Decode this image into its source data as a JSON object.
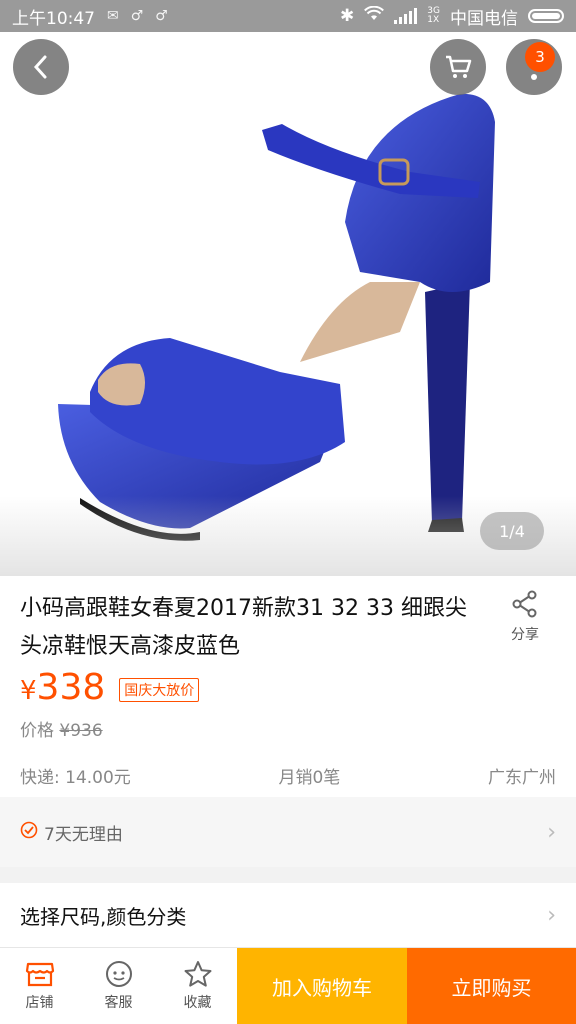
{
  "status_bar": {
    "time": "上午10:47",
    "carrier": "中国电信",
    "network_top": "3G",
    "network_bottom": "1X"
  },
  "gallery": {
    "pager": "1/4",
    "cart_badge": "3"
  },
  "product": {
    "title": "小码高跟鞋女春夏2017新款31 32 33 细跟尖头凉鞋恨天高漆皮蓝色",
    "share_label": "分享",
    "currency": "¥",
    "price": "338",
    "promo_tag": "国庆大放价",
    "original_price_label": "价格",
    "original_price": "¥936",
    "shipping": "快递: 14.00元",
    "monthly_sales": "月销0笔",
    "location": "广东广州"
  },
  "guarantee": {
    "text": "7天无理由"
  },
  "options": {
    "label": "选择尺码,颜色分类"
  },
  "bottom_bar": {
    "store": "店铺",
    "service": "客服",
    "favorite": "收藏",
    "add_to_cart": "加入购物车",
    "buy_now": "立即购买"
  },
  "colors": {
    "accent": "#ff5000",
    "add_cart_bg": "#ffb400",
    "buy_now_bg": "#ff6a00",
    "shoe_blue": "#2f3fb8"
  }
}
